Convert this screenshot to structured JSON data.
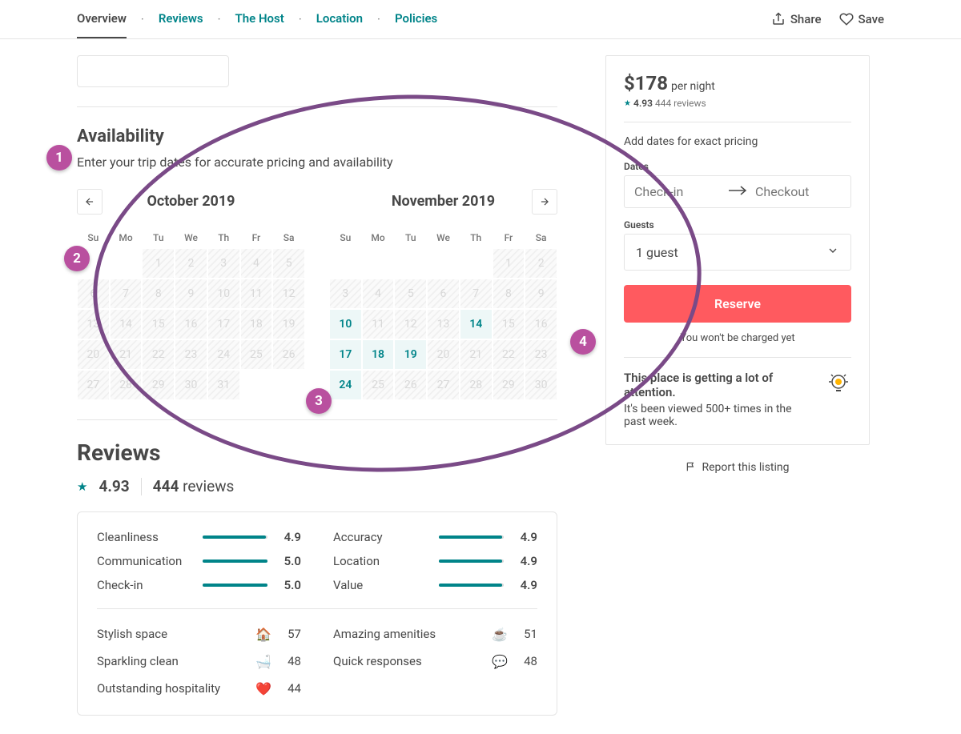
{
  "nav": {
    "tabs": [
      "Overview",
      "Reviews",
      "The Host",
      "Location",
      "Policies"
    ],
    "active": 0,
    "share": "Share",
    "save": "Save"
  },
  "availability": {
    "title": "Availability",
    "subtitle": "Enter your trip dates for accurate pricing and availability",
    "dow": [
      "Su",
      "Mo",
      "Tu",
      "We",
      "Th",
      "Fr",
      "Sa"
    ],
    "months": [
      {
        "title": "October 2019",
        "offset": 2,
        "days": [
          {
            "n": 1,
            "s": "disabled"
          },
          {
            "n": 2,
            "s": "disabled"
          },
          {
            "n": 3,
            "s": "disabled"
          },
          {
            "n": 4,
            "s": "disabled"
          },
          {
            "n": 5,
            "s": "disabled"
          },
          {
            "n": 6,
            "s": "disabled"
          },
          {
            "n": 7,
            "s": "disabled"
          },
          {
            "n": 8,
            "s": "disabled"
          },
          {
            "n": 9,
            "s": "disabled"
          },
          {
            "n": 10,
            "s": "disabled"
          },
          {
            "n": 11,
            "s": "disabled"
          },
          {
            "n": 12,
            "s": "disabled"
          },
          {
            "n": 13,
            "s": "disabled"
          },
          {
            "n": 14,
            "s": "disabled"
          },
          {
            "n": 15,
            "s": "disabled"
          },
          {
            "n": 16,
            "s": "disabled"
          },
          {
            "n": 17,
            "s": "disabled"
          },
          {
            "n": 18,
            "s": "disabled"
          },
          {
            "n": 19,
            "s": "disabled"
          },
          {
            "n": 20,
            "s": "disabled"
          },
          {
            "n": 21,
            "s": "disabled"
          },
          {
            "n": 22,
            "s": "disabled"
          },
          {
            "n": 23,
            "s": "disabled"
          },
          {
            "n": 24,
            "s": "disabled"
          },
          {
            "n": 25,
            "s": "disabled"
          },
          {
            "n": 26,
            "s": "disabled"
          },
          {
            "n": 27,
            "s": "disabled"
          },
          {
            "n": 28,
            "s": "disabled"
          },
          {
            "n": 29,
            "s": "disabled"
          },
          {
            "n": 30,
            "s": "disabled"
          },
          {
            "n": 31,
            "s": "disabled"
          }
        ]
      },
      {
        "title": "November 2019",
        "offset": 5,
        "days": [
          {
            "n": 1,
            "s": "disabled"
          },
          {
            "n": 2,
            "s": "disabled"
          },
          {
            "n": 3,
            "s": "disabled"
          },
          {
            "n": 4,
            "s": "disabled"
          },
          {
            "n": 5,
            "s": "disabled"
          },
          {
            "n": 6,
            "s": "disabled"
          },
          {
            "n": 7,
            "s": "disabled"
          },
          {
            "n": 8,
            "s": "disabled"
          },
          {
            "n": 9,
            "s": "disabled"
          },
          {
            "n": 10,
            "s": "avail"
          },
          {
            "n": 11,
            "s": "disabled"
          },
          {
            "n": 12,
            "s": "disabled"
          },
          {
            "n": 13,
            "s": "disabled"
          },
          {
            "n": 14,
            "s": "avail"
          },
          {
            "n": 15,
            "s": "disabled"
          },
          {
            "n": 16,
            "s": "disabled"
          },
          {
            "n": 17,
            "s": "avail"
          },
          {
            "n": 18,
            "s": "avail"
          },
          {
            "n": 19,
            "s": "avail"
          },
          {
            "n": 20,
            "s": "disabled"
          },
          {
            "n": 21,
            "s": "disabled"
          },
          {
            "n": 22,
            "s": "disabled"
          },
          {
            "n": 23,
            "s": "disabled"
          },
          {
            "n": 24,
            "s": "avail"
          },
          {
            "n": 25,
            "s": "disabled"
          },
          {
            "n": 26,
            "s": "disabled"
          },
          {
            "n": 27,
            "s": "disabled"
          },
          {
            "n": 28,
            "s": "disabled"
          },
          {
            "n": 29,
            "s": "disabled"
          },
          {
            "n": 30,
            "s": "disabled"
          }
        ]
      }
    ]
  },
  "reviews": {
    "title": "Reviews",
    "rating": "4.93",
    "count": "444",
    "count_label": "reviews",
    "categories": [
      {
        "label": "Cleanliness",
        "value": "4.9",
        "pct": 98
      },
      {
        "label": "Accuracy",
        "value": "4.9",
        "pct": 98
      },
      {
        "label": "Communication",
        "value": "5.0",
        "pct": 100
      },
      {
        "label": "Location",
        "value": "4.9",
        "pct": 98
      },
      {
        "label": "Check-in",
        "value": "5.0",
        "pct": 100
      },
      {
        "label": "Value",
        "value": "4.9",
        "pct": 98
      }
    ],
    "badges_left": [
      {
        "label": "Stylish space",
        "icon": "🏠",
        "count": "57"
      },
      {
        "label": "Sparkling clean",
        "icon": "🛁",
        "count": "48"
      },
      {
        "label": "Outstanding hospitality",
        "icon": "❤️",
        "count": "44"
      }
    ],
    "badges_right": [
      {
        "label": "Amazing amenities",
        "icon": "☕",
        "count": "51"
      },
      {
        "label": "Quick responses",
        "icon": "💬",
        "count": "48"
      }
    ]
  },
  "booking": {
    "price": "$178",
    "per": "per night",
    "rating": "4.93",
    "rcount": "444 reviews",
    "add_dates": "Add dates for exact pricing",
    "dates_label": "Dates",
    "checkin": "Check-in",
    "checkout": "Checkout",
    "guests_label": "Guests",
    "guests_value": "1 guest",
    "reserve": "Reserve",
    "nocharge": "You won't be charged yet",
    "attn_head": "This place is getting a lot of attention.",
    "attn_body": "It's been viewed 500+ times in the past week.",
    "report": "Report this listing"
  },
  "annotations": {
    "1": "1",
    "2": "2",
    "3": "3",
    "4": "4"
  }
}
